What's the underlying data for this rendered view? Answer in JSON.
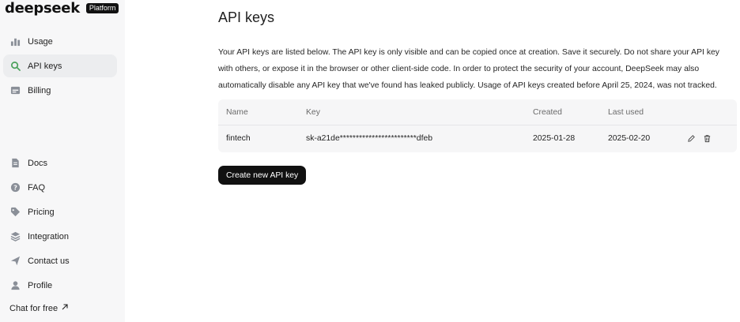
{
  "brand": {
    "logo": "deepseek",
    "badge": "Platform"
  },
  "sidebar": {
    "items": [
      {
        "label": "Usage",
        "icon": "bar-chart-icon",
        "active": false
      },
      {
        "label": "API keys",
        "icon": "search-icon",
        "active": true
      },
      {
        "label": "Billing",
        "icon": "wallet-icon",
        "active": false
      },
      {
        "label": "Docs",
        "icon": "document-icon",
        "active": false
      },
      {
        "label": "FAQ",
        "icon": "help-icon",
        "active": false
      },
      {
        "label": "Pricing",
        "icon": "tag-icon",
        "active": false
      },
      {
        "label": "Integration",
        "icon": "layers-icon",
        "active": false
      },
      {
        "label": "Contact us",
        "icon": "send-icon",
        "active": false
      },
      {
        "label": "Profile",
        "icon": "user-icon",
        "active": false
      }
    ],
    "chat_free": "Chat for free"
  },
  "main": {
    "title": "API keys",
    "description_lines": [
      "Your API keys are listed below. The API key is only visible and can be copied once at creation. Save it securely. Do not share your API key",
      "with others, or expose it in the browser or other client-side code. In order to protect the security of your account, DeepSeek may also",
      "automatically disable any API key that we've found has leaked publicly. Usage of API keys created before April 25, 2024, was not tracked."
    ],
    "table": {
      "headers": {
        "name": "Name",
        "key": "Key",
        "created": "Created",
        "last_used": "Last used"
      },
      "rows": [
        {
          "name": "fintech",
          "key": "sk-a21de************************dfeb",
          "created": "2025-01-28",
          "last_used": "2025-02-20"
        }
      ]
    },
    "create_label": "Create new API key"
  },
  "colors": {
    "accent": "#4aa05a",
    "sidebar_bg": "#f7f7f8",
    "button_bg": "#111111",
    "table_bg": "#f6f6f7"
  }
}
